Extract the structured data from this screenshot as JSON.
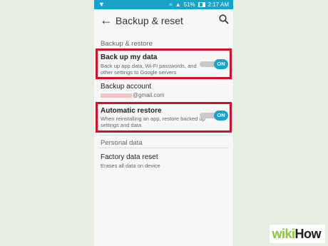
{
  "status_bar": {
    "battery": "51%",
    "time": "2:17 AM"
  },
  "app_bar": {
    "title": "Backup & reset"
  },
  "sections": {
    "backup_restore_header": "Backup & restore",
    "personal_data_header": "Personal data"
  },
  "items": {
    "back_up": {
      "title": "Back up my data",
      "desc": "Back up app data, Wi-Fi passwords, and other settings to Google servers",
      "toggle": "ON"
    },
    "backup_account": {
      "title": "Backup account",
      "email_suffix": "@gmail.com"
    },
    "auto_restore": {
      "title": "Automatic restore",
      "desc": "When reinstalling an app, restore backed up settings and data",
      "toggle": "ON"
    },
    "factory_reset": {
      "title": "Factory data reset",
      "desc": "Erases all data on device"
    }
  },
  "watermark": {
    "wiki": "wiki",
    "how": "How"
  },
  "colors": {
    "accent": "#1aa3c8",
    "highlight": "#d0112b",
    "background": "#e6eee1",
    "wikihow_green": "#8cc63f"
  }
}
